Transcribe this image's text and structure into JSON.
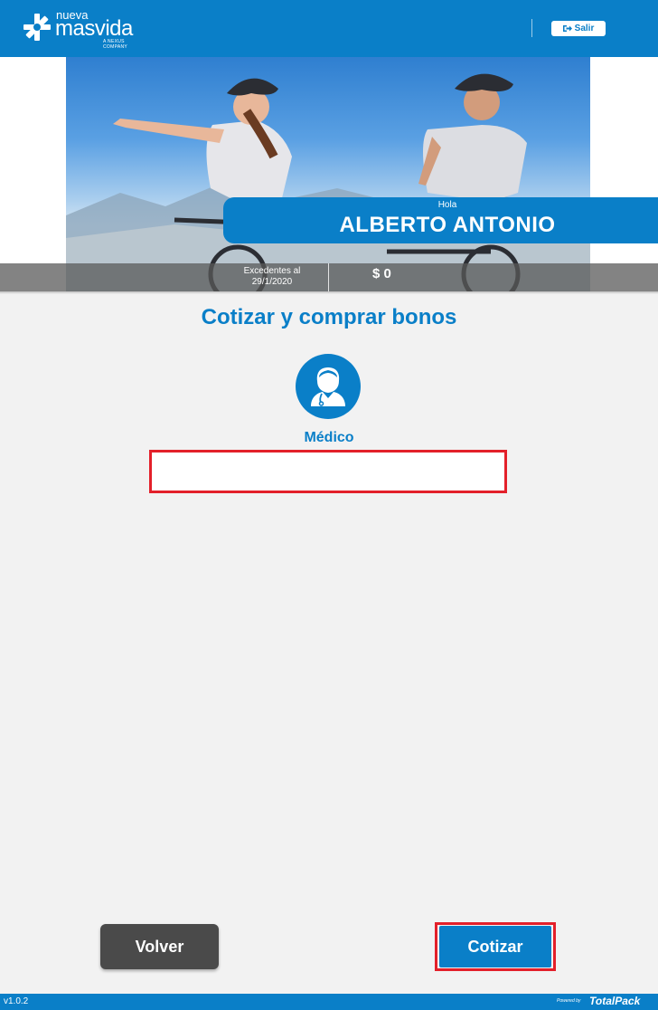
{
  "header": {
    "logo": {
      "prefix": "nueva",
      "name": "masvida",
      "tagline": "A NEXUS COMPANY"
    },
    "logout_label": "Salir"
  },
  "banner": {
    "greeting": "Hola",
    "user_name": "ALBERTO ANTONIO",
    "surplus_label": "Excedentes al 29/1/2020",
    "surplus_amount": "$ 0"
  },
  "main": {
    "title": "Cotizar y comprar bonos",
    "professional_type": "Médico",
    "search_value": "",
    "search_placeholder": ""
  },
  "actions": {
    "back_label": "Volver",
    "quote_label": "Cotizar"
  },
  "footer": {
    "version": "v1.0.2",
    "powered_prefix": "Powered by",
    "powered_brand": "TotalPack"
  },
  "colors": {
    "primary": "#0a7fc8",
    "highlight": "#e3202a",
    "back_button": "#4a4a4a",
    "background": "#f2f2f2"
  }
}
